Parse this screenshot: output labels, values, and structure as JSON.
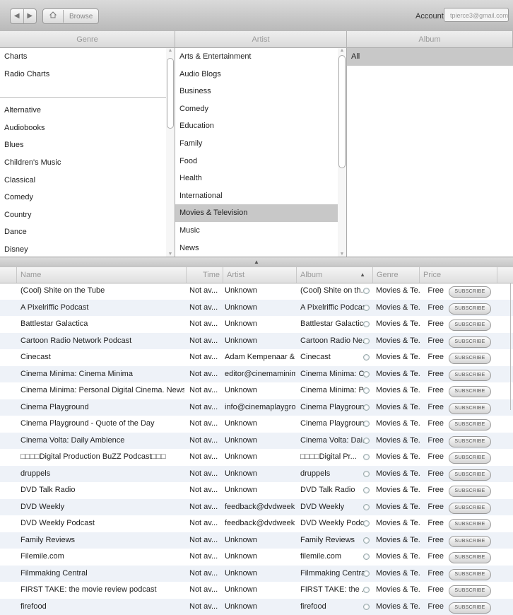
{
  "nav": {
    "back": "◀",
    "forward": "▶",
    "home_icon": "home-icon",
    "breadcrumb": "Browse"
  },
  "account": {
    "label": "Account:",
    "value": "tpierce3@gmail.com"
  },
  "browse": {
    "headers": [
      "Genre",
      "Artist",
      "Album"
    ],
    "genre_top": [
      "Charts",
      "Radio Charts"
    ],
    "genre_items": [
      "Alternative",
      "Audiobooks",
      "Blues",
      "Children's Music",
      "Classical",
      "Comedy",
      "Country",
      "Dance",
      "Disney"
    ],
    "artist_items": [
      "Arts & Entertainment",
      "Audio Blogs",
      "Business",
      "Comedy",
      "Education",
      "Family",
      "Food",
      "Health",
      "International",
      "Movies & Television",
      "Music",
      "News"
    ],
    "artist_selected": "Movies & Television",
    "album_items": [
      "All"
    ]
  },
  "table": {
    "columns": {
      "name": "Name",
      "time": "Time",
      "artist": "Artist",
      "album": "Album",
      "genre": "Genre",
      "price": "Price"
    },
    "sort_indicator": "▲",
    "subscribe_label": "SUBSCRIBE",
    "rows": [
      {
        "name": "(Cool) Shite on the Tube",
        "time": "Not av...",
        "artist": "Unknown",
        "album": "(Cool) Shite on th...",
        "genre": "Movies & Te...",
        "price": "Free"
      },
      {
        "name": "A Pixelriffic Podcast",
        "time": "Not av...",
        "artist": "Unknown",
        "album": "A Pixelriffic Podcast",
        "genre": "Movies & Te...",
        "price": "Free"
      },
      {
        "name": "Battlestar Galactica",
        "time": "Not av...",
        "artist": "Unknown",
        "album": "Battlestar Galactica",
        "genre": "Movies & Te...",
        "price": "Free"
      },
      {
        "name": "Cartoon Radio Network Podcast",
        "time": "Not av...",
        "artist": "Unknown",
        "album": "Cartoon Radio Ne...",
        "genre": "Movies & Te...",
        "price": "Free"
      },
      {
        "name": "Cinecast",
        "time": "Not av...",
        "artist": "Adam Kempenaar & S...",
        "album": "Cinecast",
        "genre": "Movies & Te...",
        "price": "Free"
      },
      {
        "name": "Cinema Minima: Cinema Minima",
        "time": "Not av...",
        "artist": "editor@cinemaminima...",
        "album": "Cinema Minima: Ci...",
        "genre": "Movies & Te...",
        "price": "Free"
      },
      {
        "name": "Cinema Minima: Personal Digital Cinema. News servic...",
        "time": "Not av...",
        "artist": "Unknown",
        "album": "Cinema Minima: P...",
        "genre": "Movies & Te...",
        "price": "Free"
      },
      {
        "name": "Cinema Playground",
        "time": "Not av...",
        "artist": "info@cinemaplaygrou...",
        "album": "Cinema Playground",
        "genre": "Movies & Te...",
        "price": "Free"
      },
      {
        "name": "Cinema Playground - Quote of the Day",
        "time": "Not av...",
        "artist": "Unknown",
        "album": "Cinema Playgroun...",
        "genre": "Movies & Te...",
        "price": "Free"
      },
      {
        "name": "Cinema Volta: Daily Ambience",
        "time": "Not av...",
        "artist": "Unknown",
        "album": "Cinema Volta: Dai...",
        "genre": "Movies & Te...",
        "price": "Free"
      },
      {
        "name": "□□□□Digital Production BuZZ Podcast□□□",
        "time": "Not av...",
        "artist": "Unknown",
        "album": "□□□□Digital Pr...",
        "genre": "Movies & Te...",
        "price": "Free"
      },
      {
        "name": "druppels",
        "time": "Not av...",
        "artist": "Unknown",
        "album": "druppels",
        "genre": "Movies & Te...",
        "price": "Free"
      },
      {
        "name": "DVD Talk Radio",
        "time": "Not av...",
        "artist": "Unknown",
        "album": "DVD Talk Radio",
        "genre": "Movies & Te...",
        "price": "Free"
      },
      {
        "name": "DVD Weekly",
        "time": "Not av...",
        "artist": "feedback@dvdweekl...",
        "album": "DVD Weekly",
        "genre": "Movies & Te...",
        "price": "Free"
      },
      {
        "name": "DVD Weekly Podcast",
        "time": "Not av...",
        "artist": "feedback@dvdweekl...",
        "album": "DVD Weekly Podcast",
        "genre": "Movies & Te...",
        "price": "Free"
      },
      {
        "name": "Family Reviews",
        "time": "Not av...",
        "artist": "Unknown",
        "album": "Family Reviews",
        "genre": "Movies & Te...",
        "price": "Free"
      },
      {
        "name": "Filemile.com",
        "time": "Not av...",
        "artist": "Unknown",
        "album": "filemile.com",
        "genre": "Movies & Te...",
        "price": "Free"
      },
      {
        "name": "Filmmaking Central",
        "time": "Not av...",
        "artist": "Unknown",
        "album": "Filmmaking Central",
        "genre": "Movies & Te...",
        "price": "Free"
      },
      {
        "name": "FIRST TAKE: the movie review podcast",
        "time": "Not av...",
        "artist": "Unknown",
        "album": "FIRST TAKE: the ...",
        "genre": "Movies & Te...",
        "price": "Free"
      },
      {
        "name": "firefood",
        "time": "Not av...",
        "artist": "Unknown",
        "album": "firefood",
        "genre": "Movies & Te...",
        "price": "Free"
      }
    ]
  }
}
